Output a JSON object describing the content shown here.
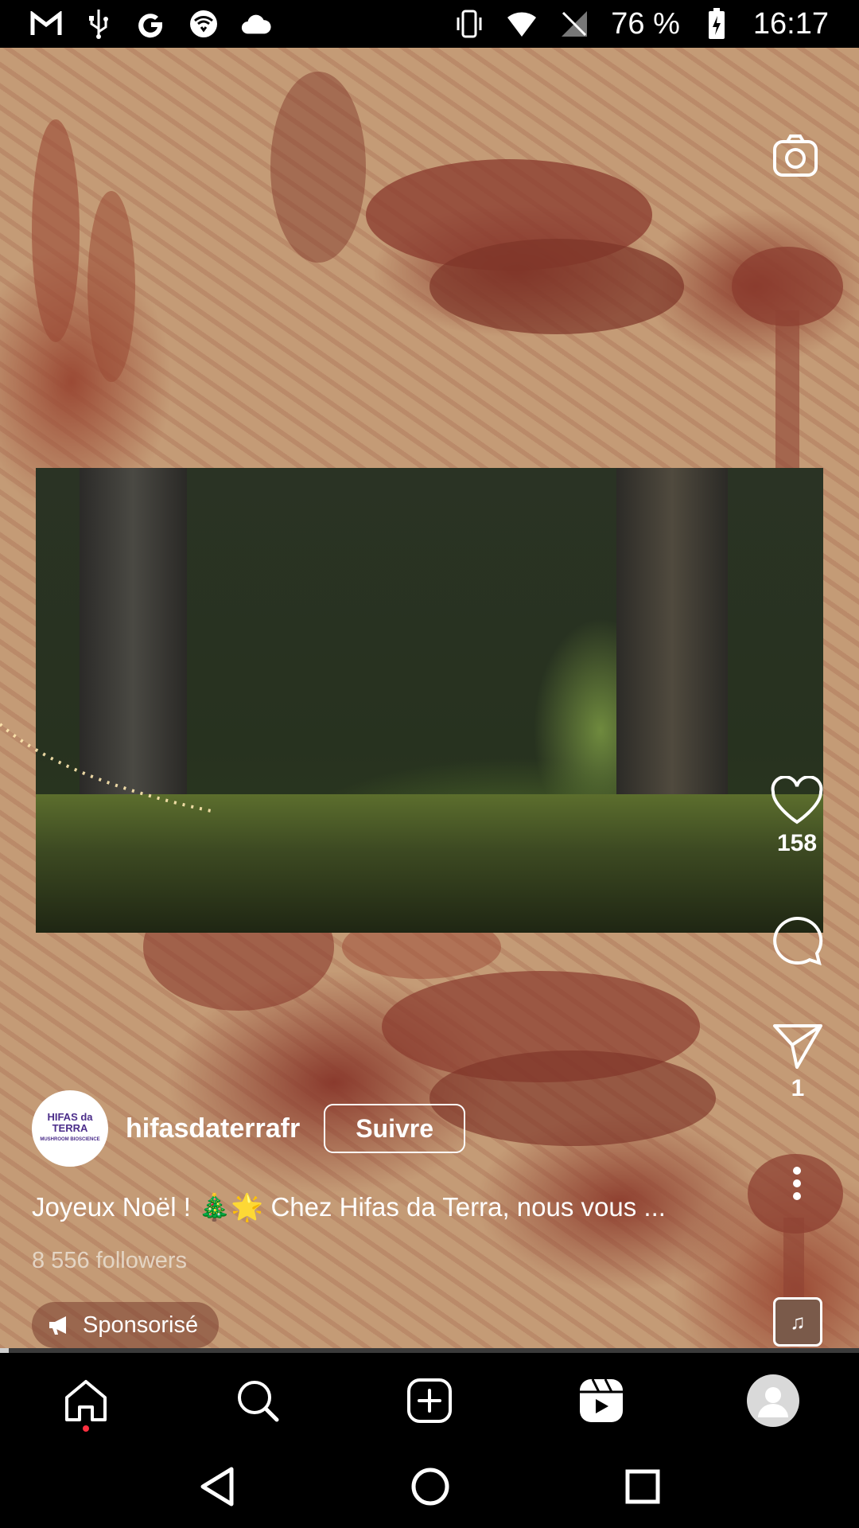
{
  "status_bar": {
    "left_icons": [
      "gmail-icon",
      "usb-icon",
      "google-icon",
      "wifi-tile-icon",
      "cloud-icon"
    ],
    "right_icons": [
      "vibrate-icon",
      "wifi-icon",
      "no-signal-icon"
    ],
    "battery_text": "76 %",
    "time": "16:17"
  },
  "reel": {
    "author": {
      "avatar_text": "HIFAS da TERRA",
      "avatar_subtext": "MUSHROOM BIOSCIENCE",
      "username": "hifasdaterrafr",
      "follow_label": "Suivre"
    },
    "caption": "Joyeux Noël ! 🎄🌟 Chez Hifas da Terra, nous vous ...",
    "followers": "8 556 followers",
    "sponsored_label": "Sponsorisé",
    "likes_count": "158",
    "shares_count": "1",
    "progress_percent": 1
  },
  "bottom_nav": {
    "items": [
      "home-icon",
      "search-icon",
      "create-icon",
      "reels-icon",
      "profile-avatar"
    ],
    "active": "home-icon"
  },
  "system_nav": [
    "back",
    "home",
    "recents"
  ],
  "colors": {
    "background_tint": "#c49b76",
    "pattern_red": "#8a3a2d",
    "notification_dot": "#ff3040"
  }
}
